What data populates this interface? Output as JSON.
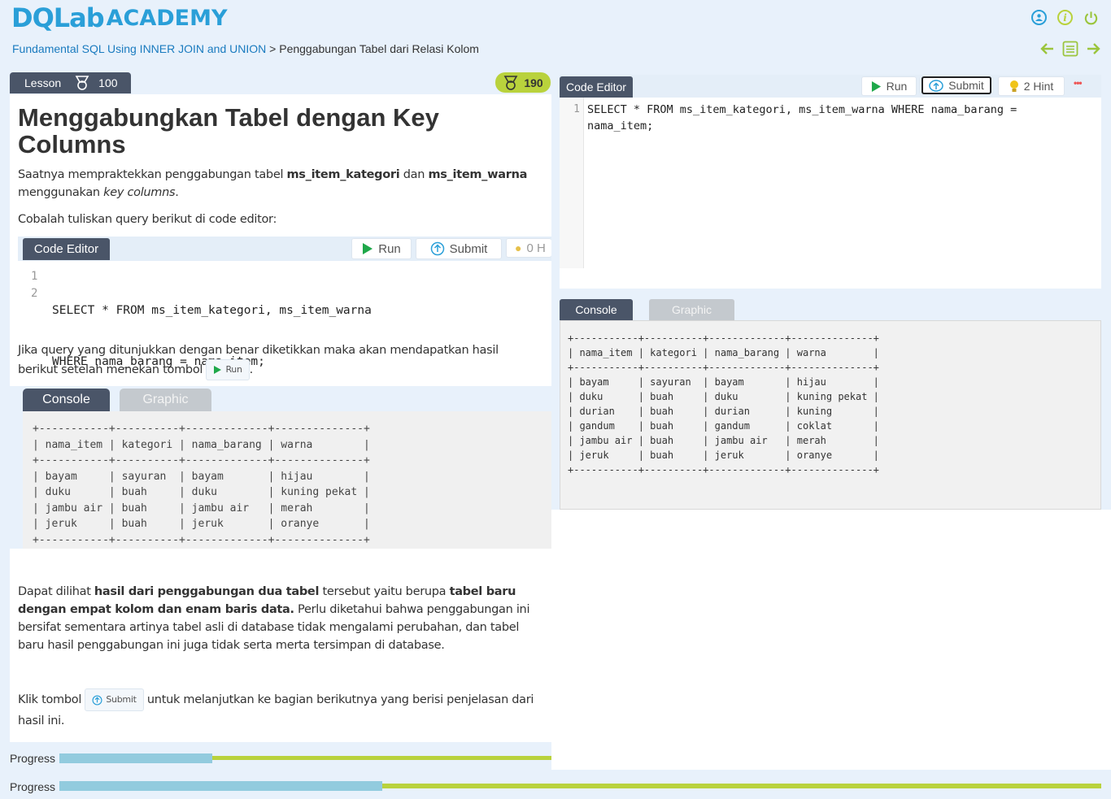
{
  "header": {
    "logo_left": "DQLab",
    "logo_right": "ACADEMY",
    "icons": [
      "user-icon",
      "info-icon",
      "power-icon"
    ],
    "colors": {
      "brand_blue": "#2a9fd8",
      "brand_green": "#b9d23c"
    }
  },
  "breadcrumb": {
    "course": "Fundamental SQL Using INNER JOIN and UNION",
    "separator": ">",
    "current": "Penggabungan Tabel dari Relasi Kolom"
  },
  "lesson": {
    "tab_label": "Lesson",
    "tab_points": "100",
    "badge_points": "190",
    "title": "Menggabungkan Tabel dengan Key Columns",
    "p1": {
      "a": "Saatnya  mempraktekkan penggabungan tabel ",
      "b1": "ms_item_kategori",
      "c": " dan ",
      "b2": "ms_item_warna",
      "d": " menggunakan ",
      "i": "key columns",
      "e": "."
    },
    "p2": "Cobalah tuliskan query berikut di code editor:",
    "embedded_editor": {
      "tab": "Code Editor",
      "run": "Run",
      "submit": "Submit",
      "hint": "0 H",
      "lines": [
        "SELECT * FROM ms_item_kategori, ms_item_warna",
        "WHERE nama_barang = nama_item;"
      ],
      "line_numbers": [
        "1",
        "2"
      ]
    },
    "p3": {
      "a": "Jika query yang ditunjukkan dengan benar diketikkan maka akan mendapatkan hasil berikut setelah menekan tombol ",
      "btn": "Run",
      "b": "."
    },
    "embedded_console": {
      "console_tab": "Console",
      "graphic_tab": "Graphic",
      "output": "+-----------+----------+-------------+--------------+\n| nama_item | kategori | nama_barang | warna        |\n+-----------+----------+-------------+--------------+\n| bayam     | sayuran  | bayam       | hijau        |\n| duku      | buah     | duku        | kuning pekat |\n| jambu air | buah     | jambu air   | merah        |\n| jeruk     | buah     | jeruk       | oranye       |\n+-----------+----------+-------------+--------------+"
    },
    "p4": {
      "a": "Dapat dilihat ",
      "b1": "hasil dari penggabungan dua tabel",
      "c": " tersebut yaitu berupa ",
      "b2": "tabel baru dengan empat kolom dan enam baris data.",
      "d": " Perlu diketahui bahwa penggabungan ini bersifat sementara artinya tabel asli di database tidak mengalami perubahan, dan tabel baru hasil penggabungan ini juga tidak serta merta tersimpan di database."
    },
    "p5": {
      "a": "Klik tombol ",
      "btn": "Submit",
      "b": " untuk melanjutkan ke bagian berikutnya yang berisi penjelasan dari hasil ini."
    }
  },
  "editor": {
    "tab": "Code Editor",
    "run": "Run",
    "submit": "Submit",
    "hint": "2 Hint",
    "more": "•••",
    "line_number": "1",
    "code": "SELECT * FROM ms_item_kategori, ms_item_warna WHERE nama_barang =\nnama_item;"
  },
  "console": {
    "console_tab": "Console",
    "graphic_tab": "Graphic",
    "output": "+-----------+----------+-------------+--------------+\n| nama_item | kategori | nama_barang | warna        |\n+-----------+----------+-------------+--------------+\n| bayam     | sayuran  | bayam       | hijau        |\n| duku      | buah     | duku        | kuning pekat |\n| durian    | buah     | durian      | kuning       |\n| gandum    | buah     | gandum      | coklat       |\n| jambu air | buah     | jambu air   | merah        |\n| jeruk     | buah     | jeruk       | oranye       |\n+-----------+----------+-------------+--------------+"
  },
  "progress": {
    "label": "Progress",
    "fraction": 0.31,
    "colors": {
      "done": "#92cbde",
      "remaining": "#b9d23c"
    }
  }
}
